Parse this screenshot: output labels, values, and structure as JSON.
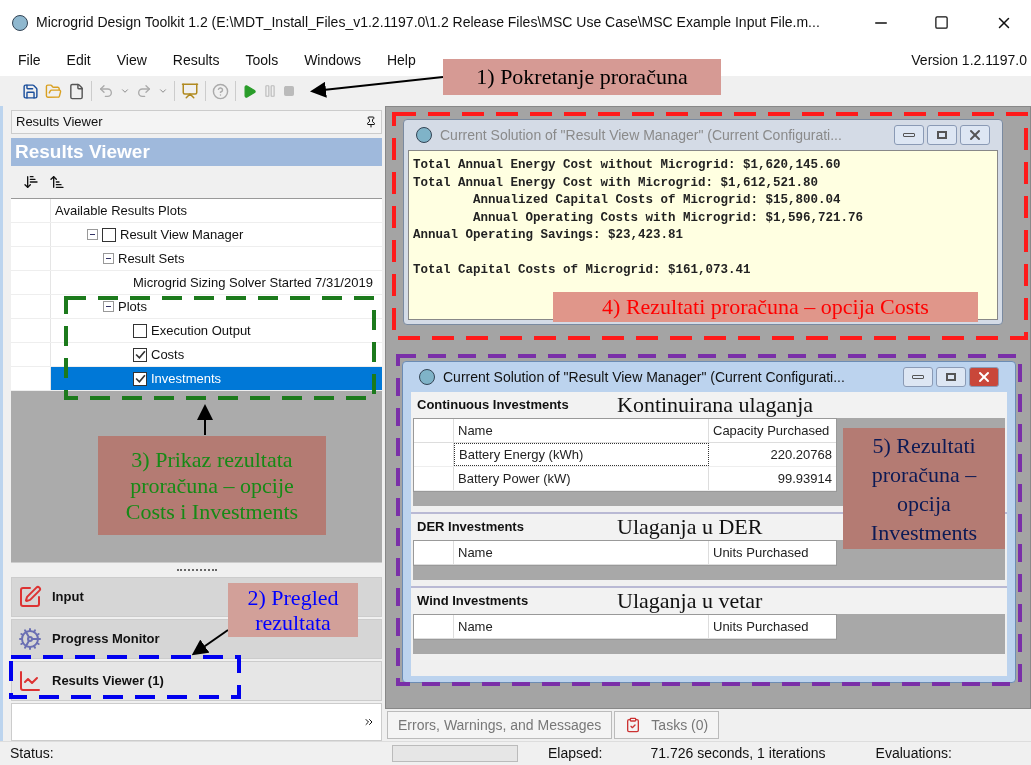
{
  "window": {
    "title": "Microgrid Design Toolkit 1.2 (E:\\MDT_Install_Files_v1.2.1197.0\\1.2 Release Files\\MSC Use Case\\MSC Example Input File.m..."
  },
  "menu": [
    {
      "label": "File"
    },
    {
      "label": "Edit"
    },
    {
      "label": "View"
    },
    {
      "label": "Results"
    },
    {
      "label": "Tools"
    },
    {
      "label": "Windows"
    },
    {
      "label": "Help"
    }
  ],
  "version": "Version 1.2.1197.0",
  "left_panel": {
    "pane_title": "Results Viewer",
    "header": "Results Viewer",
    "tree": [
      {
        "label": "Available Results Plots",
        "selected": false,
        "children": [
          {
            "label": "Result View Manager",
            "expanded": true,
            "checked": false,
            "selected": false,
            "children": [
              {
                "label": "Result Sets",
                "expanded": true,
                "selected": false,
                "children": [
                  {
                    "label": "Microgrid Sizing Solver Started 7/31/2019",
                    "selected": false
                  }
                ]
              },
              {
                "label": "Plots",
                "expanded": true,
                "selected": false,
                "children": [
                  {
                    "label": "Execution Output",
                    "checked": false,
                    "selected": false
                  },
                  {
                    "label": "Costs",
                    "checked": true,
                    "selected": false
                  },
                  {
                    "label": "Investments",
                    "checked": true,
                    "selected": true
                  }
                ]
              }
            ]
          }
        ]
      }
    ],
    "nav": [
      {
        "label": "Input",
        "kind": "input",
        "selected": false
      },
      {
        "label": "Progress Monitor",
        "kind": "progress",
        "selected": false
      },
      {
        "label": "Results Viewer (1)",
        "kind": "results",
        "selected": true
      }
    ]
  },
  "costs_window": {
    "title": "Current Solution of \"Result View Manager\" (Current Configurati...",
    "active": false,
    "blocks": [
      [
        {
          "text": "Total Annual Energy Cost without Microgrid: $1,620,145.60"
        },
        {
          "text": "Total Annual Energy Cost with Microgrid: $1,612,521.80",
          "children": [
            {
              "text": "Annualized Capital Costs of Microgrid: $15,800.04"
            },
            {
              "text": "Annual Operating Costs with Microgrid: $1,596,721.76"
            }
          ]
        },
        {
          "text": "Annual Operating Savings: $23,423.81"
        }
      ],
      [
        {
          "text": "Total Capital Costs of Microgrid: $161,073.41"
        }
      ]
    ]
  },
  "investments_window": {
    "title": "Current Solution of \"Result View Manager\" (Current Configurati...",
    "active": true,
    "sections": [
      {
        "title": "Continuous Investments",
        "note": "Kontinuirana ulaganja",
        "columns": [
          "Name",
          "Capacity Purchased"
        ],
        "rows": [
          {
            "cells": [
              "Battery Energy (kWh)",
              "220.20768"
            ],
            "focused": true
          },
          {
            "cells": [
              "Battery Power (kW)",
              "99.93914"
            ],
            "focused": false
          }
        ]
      },
      {
        "title": "DER Investments",
        "note": "Ulaganja u DER",
        "columns": [
          "Name",
          "Units Purchased"
        ]
      },
      {
        "title": "Wind Investments",
        "note": "Ulaganja u vetar",
        "columns": [
          "Name",
          "Units Purchased"
        ]
      }
    ]
  },
  "bottom_tabs": [
    {
      "label": "Errors, Warnings, and Messages",
      "kind": "plain"
    },
    {
      "label": "Tasks (0)",
      "kind": "tasks"
    }
  ],
  "status_bar": {
    "status": "Status:",
    "elapsed_label": "Elapsed:",
    "elapsed": "71.726 seconds, 1 iterations",
    "evaluations_label": "Evaluations:"
  },
  "callouts": [
    {
      "text": "1) Pokretanje proračuna",
      "kind": "run"
    },
    {
      "text": "4) Rezultati proračuna – opcija Costs",
      "kind": "costs"
    },
    {
      "text": "3) Prikaz rezultata proračuna – opcije Costs i Investments",
      "kind": "display"
    },
    {
      "text": "5) Rezultati proračuna – opcija Investments",
      "kind": "investments"
    },
    {
      "text": "2) Pregled rezultata",
      "kind": "overview"
    }
  ]
}
